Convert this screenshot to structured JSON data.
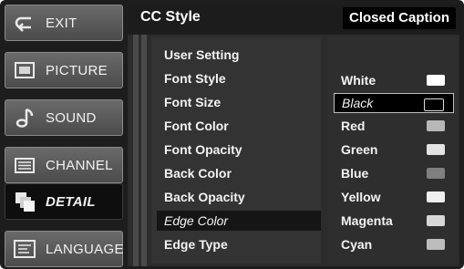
{
  "nav": [
    {
      "label": "EXIT",
      "icon": "exit-icon"
    },
    {
      "label": "PICTURE",
      "icon": "picture-icon"
    },
    {
      "label": "SOUND",
      "icon": "sound-icon"
    },
    {
      "label": "CHANNEL",
      "icon": "channel-icon"
    },
    {
      "label": "DETAIL",
      "icon": "detail-icon",
      "active": true
    },
    {
      "label": "LANGUAGE",
      "icon": "language-icon"
    }
  ],
  "header": {
    "title": "CC Style",
    "tab_label": "Closed Caption"
  },
  "menu": [
    {
      "label": "User Setting"
    },
    {
      "label": "Font Style"
    },
    {
      "label": "Font Size"
    },
    {
      "label": "Font Color"
    },
    {
      "label": "Font Opacity"
    },
    {
      "label": "Back Color"
    },
    {
      "label": "Back Opacity"
    },
    {
      "label": "Edge Color",
      "selected": true
    },
    {
      "label": "Edge Type"
    }
  ],
  "options": [
    {
      "label": "White",
      "color": "#ffffff"
    },
    {
      "label": "Black",
      "color": "#000000",
      "selected": true
    },
    {
      "label": "Red",
      "color": "#b7b7b7"
    },
    {
      "label": "Green",
      "color": "#e3e3e3"
    },
    {
      "label": "Blue",
      "color": "#7f7f7f"
    },
    {
      "label": "Yellow",
      "color": "#f0f0f0"
    },
    {
      "label": "Magenta",
      "color": "#d7d7d7"
    },
    {
      "label": "Cyan",
      "color": "#bdbdbd"
    }
  ]
}
